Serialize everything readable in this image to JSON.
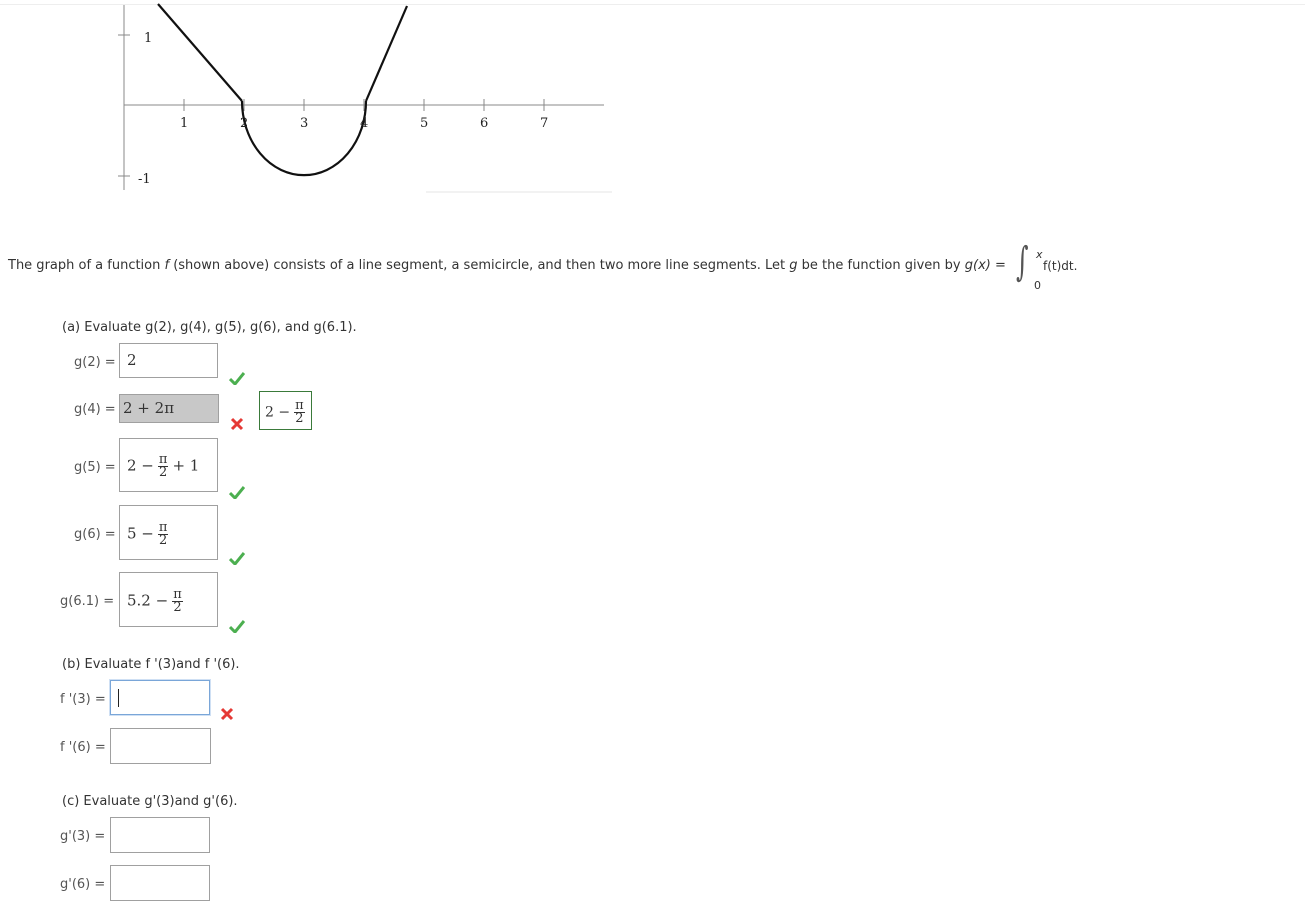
{
  "graph": {
    "x_ticks": [
      "1",
      "2",
      "3",
      "4",
      "5",
      "6",
      "7"
    ],
    "y_ticks": [
      "1",
      "-1"
    ]
  },
  "description": {
    "text_before_f": "The graph of a function ",
    "f": "f",
    "text_mid": " (shown above) consists of a line segment, a semicircle, and then two more line segments. Let ",
    "g": "g",
    "text_after_g": " be the function given by ",
    "gx": "g(x) =",
    "integral_upper": "x",
    "integral_lower": "0",
    "integrand": "f(t)dt."
  },
  "part_a": {
    "prompt": "(a) Evaluate g(2), g(4), g(5), g(6), and g(6.1).",
    "rows": [
      {
        "label": "g(2) =",
        "value": "2",
        "status": "correct"
      },
      {
        "label": "g(4) =",
        "value": "2 + 2π",
        "status": "incorrect",
        "correct_answer_prefix": "2 −",
        "correct_answer_num": "π",
        "correct_answer_den": "2"
      },
      {
        "label": "g(5) =",
        "prefix": "2 −",
        "num": "π",
        "den": "2",
        "suffix": "+ 1",
        "status": "correct"
      },
      {
        "label": "g(6) =",
        "prefix": "5 −",
        "num": "π",
        "den": "2",
        "status": "correct"
      },
      {
        "label": "g(6.1) =",
        "prefix": "5.2 −",
        "num": "π",
        "den": "2",
        "status": "correct"
      }
    ]
  },
  "part_b": {
    "prompt": "(b) Evaluate f '(3)and f '(6).",
    "rows": [
      {
        "label": "f '(3) =",
        "value": "",
        "status": "incorrect"
      },
      {
        "label": "f '(6) =",
        "value": ""
      }
    ]
  },
  "part_c": {
    "prompt": "(c) Evaluate g'(3)and g'(6).",
    "rows": [
      {
        "label": "g'(3) =",
        "value": ""
      },
      {
        "label": "g'(6) =",
        "value": ""
      }
    ]
  },
  "colors": {
    "correct": "#4caf50",
    "incorrect": "#e53935",
    "answer_border": "#3a7a3a"
  }
}
